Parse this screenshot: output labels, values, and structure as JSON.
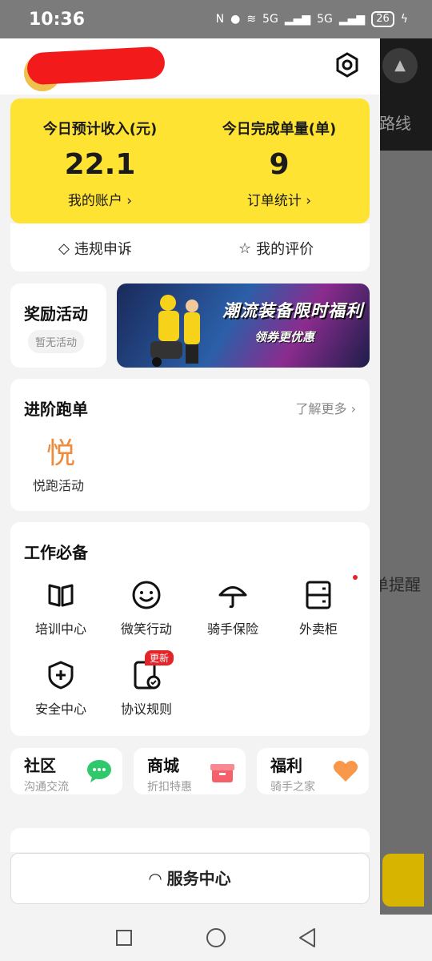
{
  "status_bar": {
    "time": "10:36",
    "battery": "26",
    "net1": "5G",
    "net2": "5G"
  },
  "background": {
    "route_text": "路线",
    "remind_text": "单提醒"
  },
  "income": {
    "left_label": "今日预计收入(元)",
    "left_value": "22.1",
    "left_link": "我的账户 ›",
    "right_label": "今日完成单量(单)",
    "right_value": "9",
    "right_link": "订单统计 ›"
  },
  "appeal": {
    "violation": "违规申诉",
    "rating": "我的评价"
  },
  "reward": {
    "title": "奖励活动",
    "status": "暂无活动"
  },
  "banner": {
    "line1": "潮流装备限时福利",
    "line2": "领券更优惠"
  },
  "advanced": {
    "title": "进阶跑单",
    "more": "了解更多 ›",
    "icon_char": "悦",
    "item": "悦跑活动"
  },
  "tools": {
    "title": "工作必备",
    "items": [
      "培训中心",
      "微笑行动",
      "骑手保险",
      "外卖柜",
      "安全中心",
      "协议规则"
    ],
    "new_tag": "更新"
  },
  "mini_cards": [
    {
      "title": "社区",
      "sub": "沟通交流"
    },
    {
      "title": "商城",
      "sub": "折扣特惠"
    },
    {
      "title": "福利",
      "sub": "骑手之家"
    }
  ],
  "service": {
    "label": "服务中心"
  }
}
